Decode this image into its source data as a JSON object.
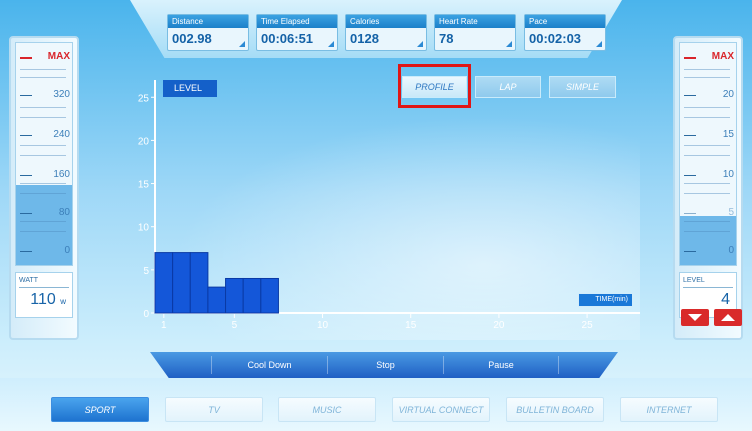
{
  "stats": [
    {
      "label": "Distance",
      "value": "002.98"
    },
    {
      "label": "Time Elapsed",
      "value": "00:06:51"
    },
    {
      "label": "Calories",
      "value": "0128"
    },
    {
      "label": "Heart Rate",
      "value": "78"
    },
    {
      "label": "Pace",
      "value": "00:02:03"
    }
  ],
  "left_meter": {
    "max_label": "MAX",
    "ticks": [
      "320",
      "240",
      "160",
      "80",
      "0"
    ],
    "fill_fraction": 0.36,
    "readout_label": "WATT",
    "readout_value": "110",
    "readout_unit": "w"
  },
  "right_meter": {
    "max_label": "MAX",
    "ticks": [
      "20",
      "15",
      "10",
      "5",
      "0"
    ],
    "fill_fraction": 0.22,
    "readout_label": "LEVEL",
    "readout_value": "4"
  },
  "tabs": {
    "profile": "PROFILE",
    "lap": "LAP",
    "simple": "SIMPLE"
  },
  "chart_data": {
    "type": "bar",
    "title": "",
    "ylabel": "LEVEL",
    "xlabel": "TIME(min)",
    "x_ticks": [
      "1",
      "5",
      "10",
      "15",
      "20",
      "25"
    ],
    "y_ticks": [
      "0",
      "5",
      "10",
      "15",
      "20",
      "25"
    ],
    "xlim": [
      0.5,
      28
    ],
    "ylim": [
      0,
      27
    ],
    "categories": [
      1,
      2,
      3,
      4,
      5,
      6,
      7
    ],
    "values": [
      7,
      7,
      7,
      3,
      4,
      4,
      4
    ],
    "bar_color": "#1457d9"
  },
  "controls": {
    "cool_down": "Cool Down",
    "stop": "Stop",
    "pause": "Pause"
  },
  "nav": [
    "SPORT",
    "TV",
    "MUSIC",
    "VIRTUAL CONNECT",
    "BULLETIN BOARD",
    "INTERNET"
  ],
  "colors": {
    "accent": "#1460c9",
    "alert": "#d92a2a",
    "highlight": "#e01515"
  }
}
